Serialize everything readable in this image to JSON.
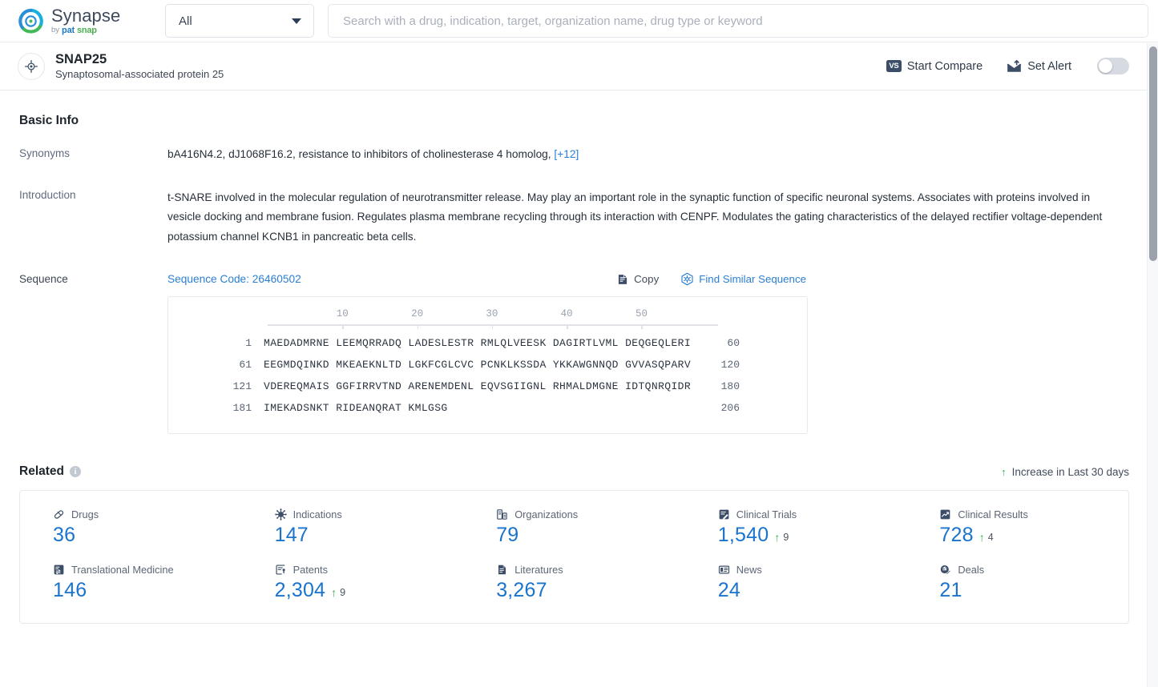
{
  "topbar": {
    "brand_name": "Synapse",
    "brand_by": "by",
    "brand_pat": "pat",
    "brand_snap": "snap",
    "category_selected": "All",
    "search_placeholder": "Search with a drug, indication, target, organization name, drug type or keyword",
    "search_value": ""
  },
  "entity": {
    "title": "SNAP25",
    "subtitle": "Synaptosomal-associated protein 25",
    "start_compare_label": "Start Compare",
    "vs_badge": "VS",
    "set_alert_label": "Set Alert",
    "alert_enabled": false
  },
  "basic_info": {
    "section_title": "Basic Info",
    "synonyms_label": "Synonyms",
    "synonyms_value": "bA416N4.2,  dJ1068F16.2,  resistance to inhibitors of cholinesterase 4 homolog,",
    "synonyms_more": "[+12]",
    "introduction_label": "Introduction",
    "introduction_value": "t-SNARE involved in the molecular regulation of neurotransmitter release. May play an important role in the synaptic function of specific neuronal systems. Associates with proteins involved in vesicle docking and membrane fusion. Regulates plasma membrane recycling through its interaction with CENPF. Modulates the gating characteristics of the delayed rectifier voltage-dependent potassium channel KCNB1 in pancreatic beta cells.",
    "sequence_label": "Sequence",
    "sequence_code": "Sequence Code: 26460502",
    "copy_label": "Copy",
    "find_similar_label": "Find Similar Sequence"
  },
  "sequence": {
    "ruler_ticks": [
      10,
      20,
      30,
      40,
      50
    ],
    "rows": [
      {
        "start": "1",
        "blocks": "MAEDADMRNE LEEMQRRADQ LADESLESTR RMLQLVEESK DAGIRTLVML DEQGEQLERI",
        "end": "60"
      },
      {
        "start": "61",
        "blocks": "EEGMDQINKD MKEAEKNLTD LGKFCGLCVC PCNKLKSSDA YKKAWGNNQD GVVASQPARV",
        "end": "120"
      },
      {
        "start": "121",
        "blocks": "VDEREQMAIS GGFIRRVTND ARENEMDENL EQVSGIIGNL RHMALDMGNE IDTQNRQIDR",
        "end": "180"
      },
      {
        "start": "181",
        "blocks": "IMEKADSNKT RIDEANQRAT KMLGSG",
        "end": "206"
      }
    ]
  },
  "related": {
    "title": "Related",
    "info_icon_char": "i",
    "legend_label": "Increase in Last 30 days",
    "legend_arrow": "↑",
    "row1": [
      {
        "icon": "pill-icon",
        "label": "Drugs",
        "value": "36",
        "delta": ""
      },
      {
        "icon": "virus-icon",
        "label": "Indications",
        "value": "147",
        "delta": ""
      },
      {
        "icon": "organization-icon",
        "label": "Organizations",
        "value": "79",
        "delta": ""
      },
      {
        "icon": "clinical-trial-icon",
        "label": "Clinical Trials",
        "value": "1,540",
        "delta": "9"
      },
      {
        "icon": "clinical-result-icon",
        "label": "Clinical Results",
        "value": "728",
        "delta": "4"
      }
    ],
    "row2": [
      {
        "icon": "translational-medicine-icon",
        "label": "Translational Medicine",
        "value": "146",
        "delta": ""
      },
      {
        "icon": "patent-icon",
        "label": "Patents",
        "value": "2,304",
        "delta": "9"
      },
      {
        "icon": "literature-icon",
        "label": "Literatures",
        "value": "3,267",
        "delta": ""
      },
      {
        "icon": "news-icon",
        "label": "News",
        "value": "24",
        "delta": ""
      },
      {
        "icon": "deal-icon",
        "label": "Deals",
        "value": "21",
        "delta": ""
      }
    ]
  },
  "colors": {
    "accent_blue": "#1a73cd",
    "link_blue": "#2a7fd4",
    "increase_green": "#2eb24c",
    "text_dark": "#20272f",
    "text_muted": "#5f6b7d",
    "border": "#e6e9ee"
  }
}
